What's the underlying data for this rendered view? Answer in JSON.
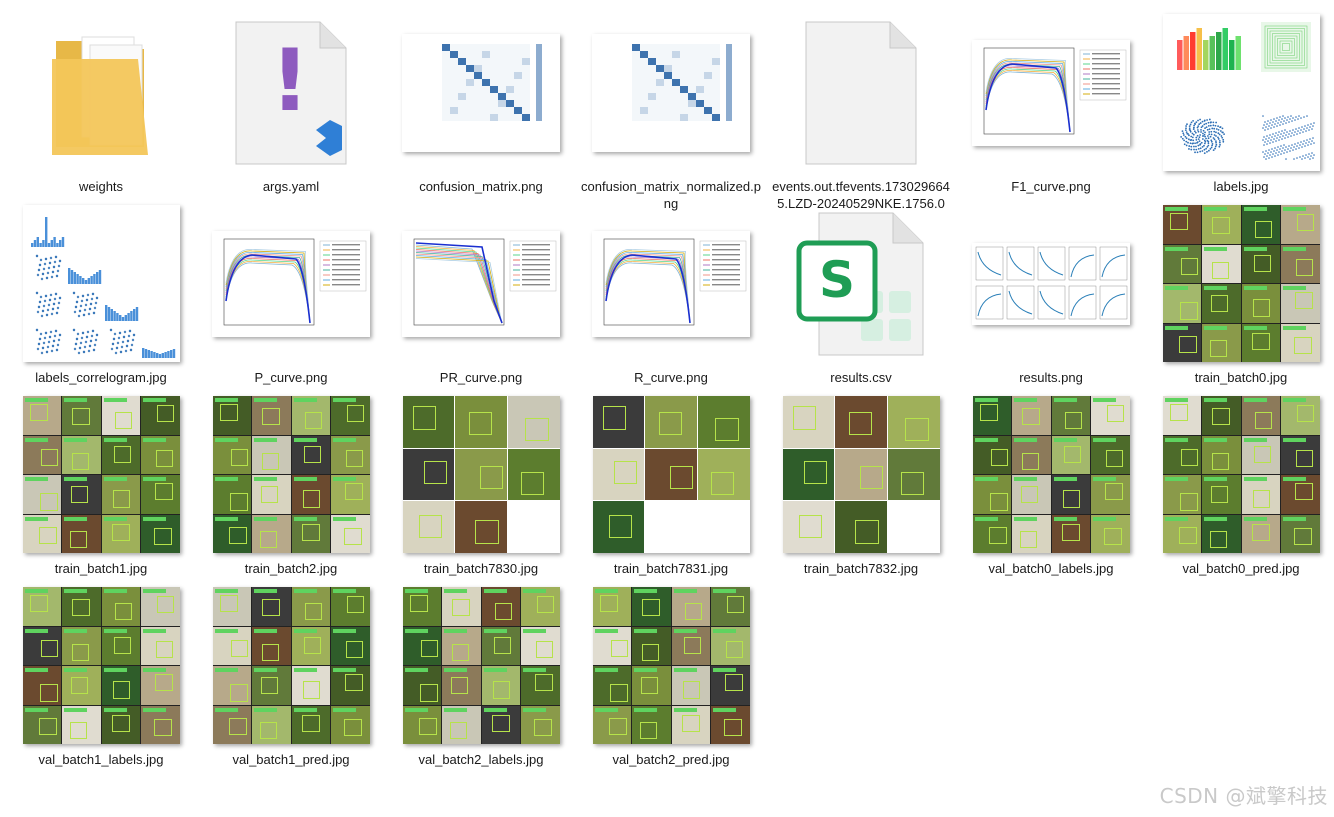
{
  "files": [
    {
      "name": "weights",
      "kind": "folder"
    },
    {
      "name": "args.yaml",
      "kind": "yaml"
    },
    {
      "name": "confusion_matrix.png",
      "kind": "matrix"
    },
    {
      "name": "confusion_matrix_normalized.png",
      "kind": "matrix"
    },
    {
      "name": "events.out.tfevents.1730296645.LZD-20240529NKE.1756.0",
      "kind": "blank"
    },
    {
      "name": "F1_curve.png",
      "kind": "curve"
    },
    {
      "name": "labels.jpg",
      "kind": "labels"
    },
    {
      "name": "labels_correlogram.jpg",
      "kind": "correlogram"
    },
    {
      "name": "P_curve.png",
      "kind": "curve"
    },
    {
      "name": "PR_curve.png",
      "kind": "prcurve"
    },
    {
      "name": "R_curve.png",
      "kind": "curve"
    },
    {
      "name": "results.csv",
      "kind": "csv"
    },
    {
      "name": "results.png",
      "kind": "results"
    },
    {
      "name": "train_batch0.jpg",
      "kind": "mosaic"
    },
    {
      "name": "train_batch1.jpg",
      "kind": "mosaic"
    },
    {
      "name": "train_batch2.jpg",
      "kind": "mosaic"
    },
    {
      "name": "train_batch7830.jpg",
      "kind": "mosaic3"
    },
    {
      "name": "train_batch7831.jpg",
      "kind": "mosaic3"
    },
    {
      "name": "train_batch7832.jpg",
      "kind": "mosaic3"
    },
    {
      "name": "val_batch0_labels.jpg",
      "kind": "mosaic"
    },
    {
      "name": "val_batch0_pred.jpg",
      "kind": "mosaic"
    },
    {
      "name": "val_batch1_labels.jpg",
      "kind": "mosaic"
    },
    {
      "name": "val_batch1_pred.jpg",
      "kind": "mosaic"
    },
    {
      "name": "val_batch2_labels.jpg",
      "kind": "mosaic"
    },
    {
      "name": "val_batch2_pred.jpg",
      "kind": "mosaic"
    }
  ],
  "icons": {
    "folder": "folder-icon",
    "yaml": "yaml-file-icon",
    "csv": "spreadsheet-file-icon",
    "blank": "generic-file-icon"
  },
  "colors": {
    "folder": "#f3c65a",
    "yaml_mark": "#8e5bbf",
    "csv_green": "#1f9d55",
    "vscode_blue": "#2f7fd6"
  },
  "watermark": "CSDN @斌擎科技"
}
